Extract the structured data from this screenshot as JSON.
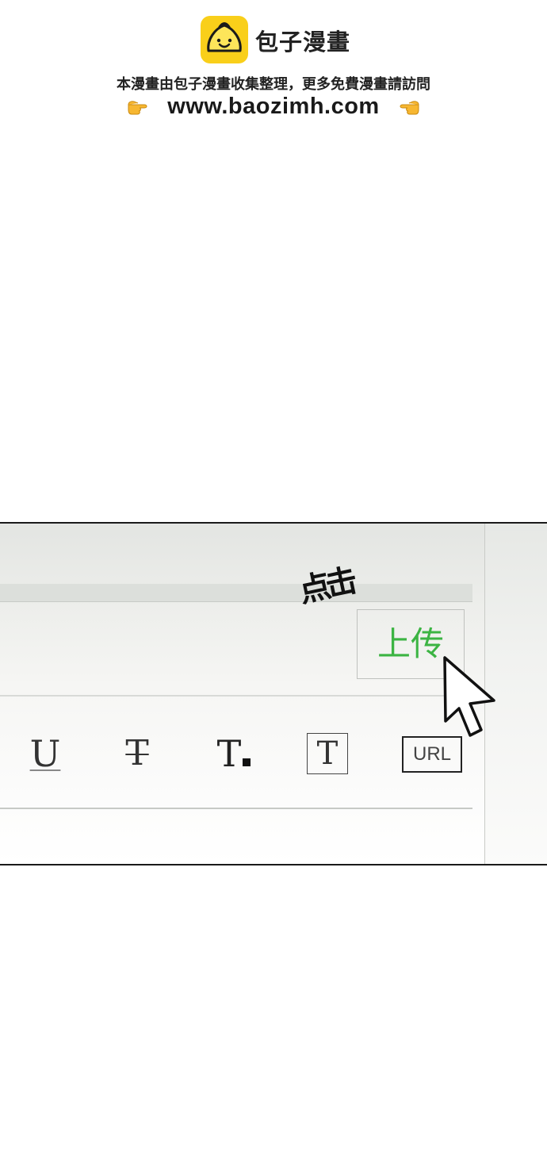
{
  "watermark": {
    "brand": "包子漫畫",
    "tagline": "本漫畫由包子漫畫收集整理，更多免費漫畫請訪問",
    "url": "www.baozimh.com",
    "logo_icon": "steamed-bun-icon",
    "hand_icon": "pointing-hand-icon",
    "logo_color": "#f9cf1a"
  },
  "panel": {
    "sfx_text": "点击",
    "upload_label": "上传",
    "upload_color": "#3cb443",
    "toolbar": {
      "underline": "U",
      "strikethrough": "T",
      "font_size": "T",
      "text_box": "T",
      "link": "URL"
    },
    "cursor_icon": "mouse-pointer-icon"
  }
}
